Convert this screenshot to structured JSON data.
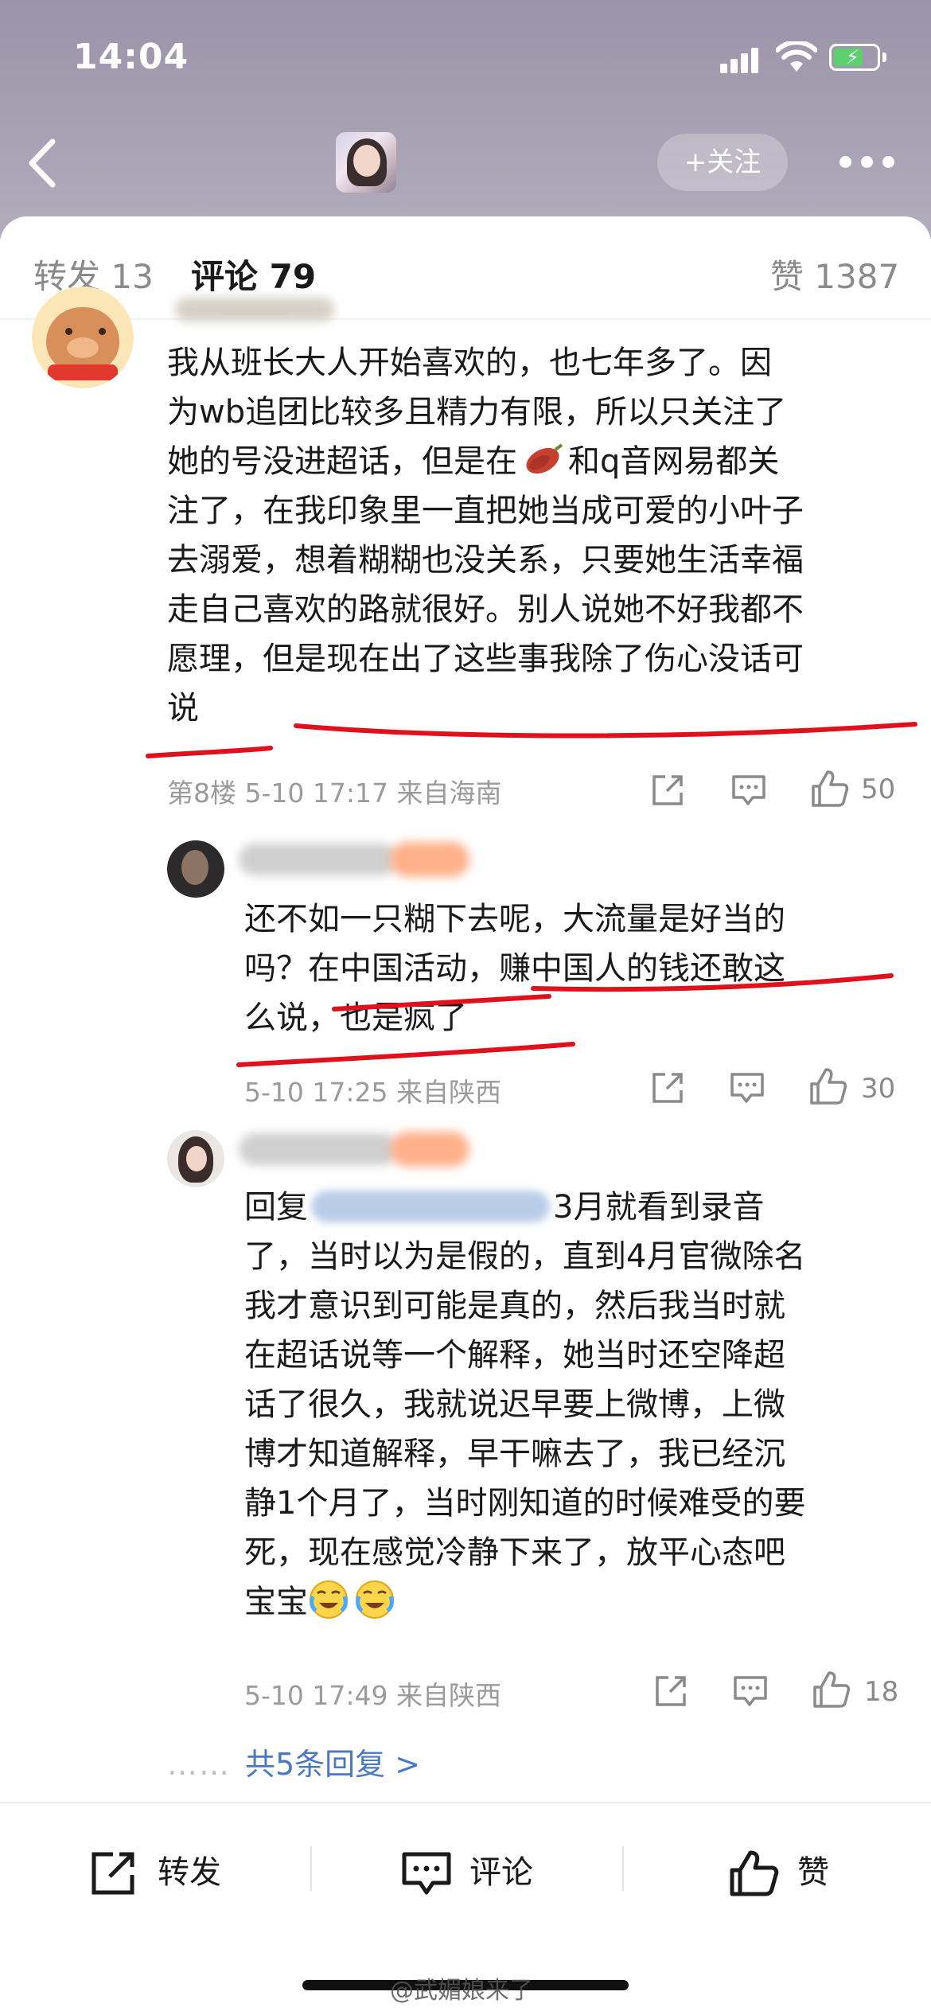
{
  "status_bar": {
    "time": "14:04"
  },
  "header": {
    "follow_label": "+关注"
  },
  "tabs": [
    {
      "label": "转发 13"
    },
    {
      "label": "评论 79"
    },
    {
      "label": "赞 1387"
    }
  ],
  "main_comment": {
    "lines": [
      "我从班长大人开始喜欢的，也七年多了。因",
      "为wb追团比较多且精力有限，所以只关注了",
      "她的号没进超话，但是在",
      "和q音网易都关",
      "注了，在我印象里一直把她当成可爱的小叶子",
      "去溺爱，想着糊糊也没关系，只要她生活幸福",
      "走自己喜欢的路就很好。别人说她不好我都不",
      "愿理，但是现在出了这些事我除了伤心没话可",
      "说"
    ],
    "meta": "第8楼 5-10 17:17 来自海南",
    "likes": "50"
  },
  "replies": [
    {
      "lines": [
        "还不如一只糊下去呢，大流量是好当的",
        "吗？在中国活动，赚中国人的钱还敢这",
        "么说，也是疯了"
      ],
      "meta": "5-10 17:25 来自陕西",
      "likes": "30"
    },
    {
      "lines": [
        "回复",
        "3月就看到录音",
        "了，当时以为是假的，直到4月官微除名",
        "我才意识到可能是真的，然后我当时就",
        "在超话说等一个解释，她当时还空降超",
        "话了很久，我就说迟早要上微博，上微",
        "博才知道解释，早干嘛去了，我已经沉",
        "静1个月了，当时刚知道的时候难受的要",
        "死，现在感觉冷静下来了，放平心态吧",
        "宝宝"
      ],
      "meta": "5-10 17:49 来自陕西",
      "likes": "18"
    }
  ],
  "more_replies": {
    "dots": "……",
    "label": "共5条回复 >"
  },
  "bottom_bar": {
    "repost_label": "转发",
    "comment_label": "评论",
    "like_label": "赞"
  },
  "watermark": "@武媚娘来了",
  "colors": {
    "accent": "#ff8200",
    "link": "#4a78c2",
    "annotation": "#e0101c"
  }
}
